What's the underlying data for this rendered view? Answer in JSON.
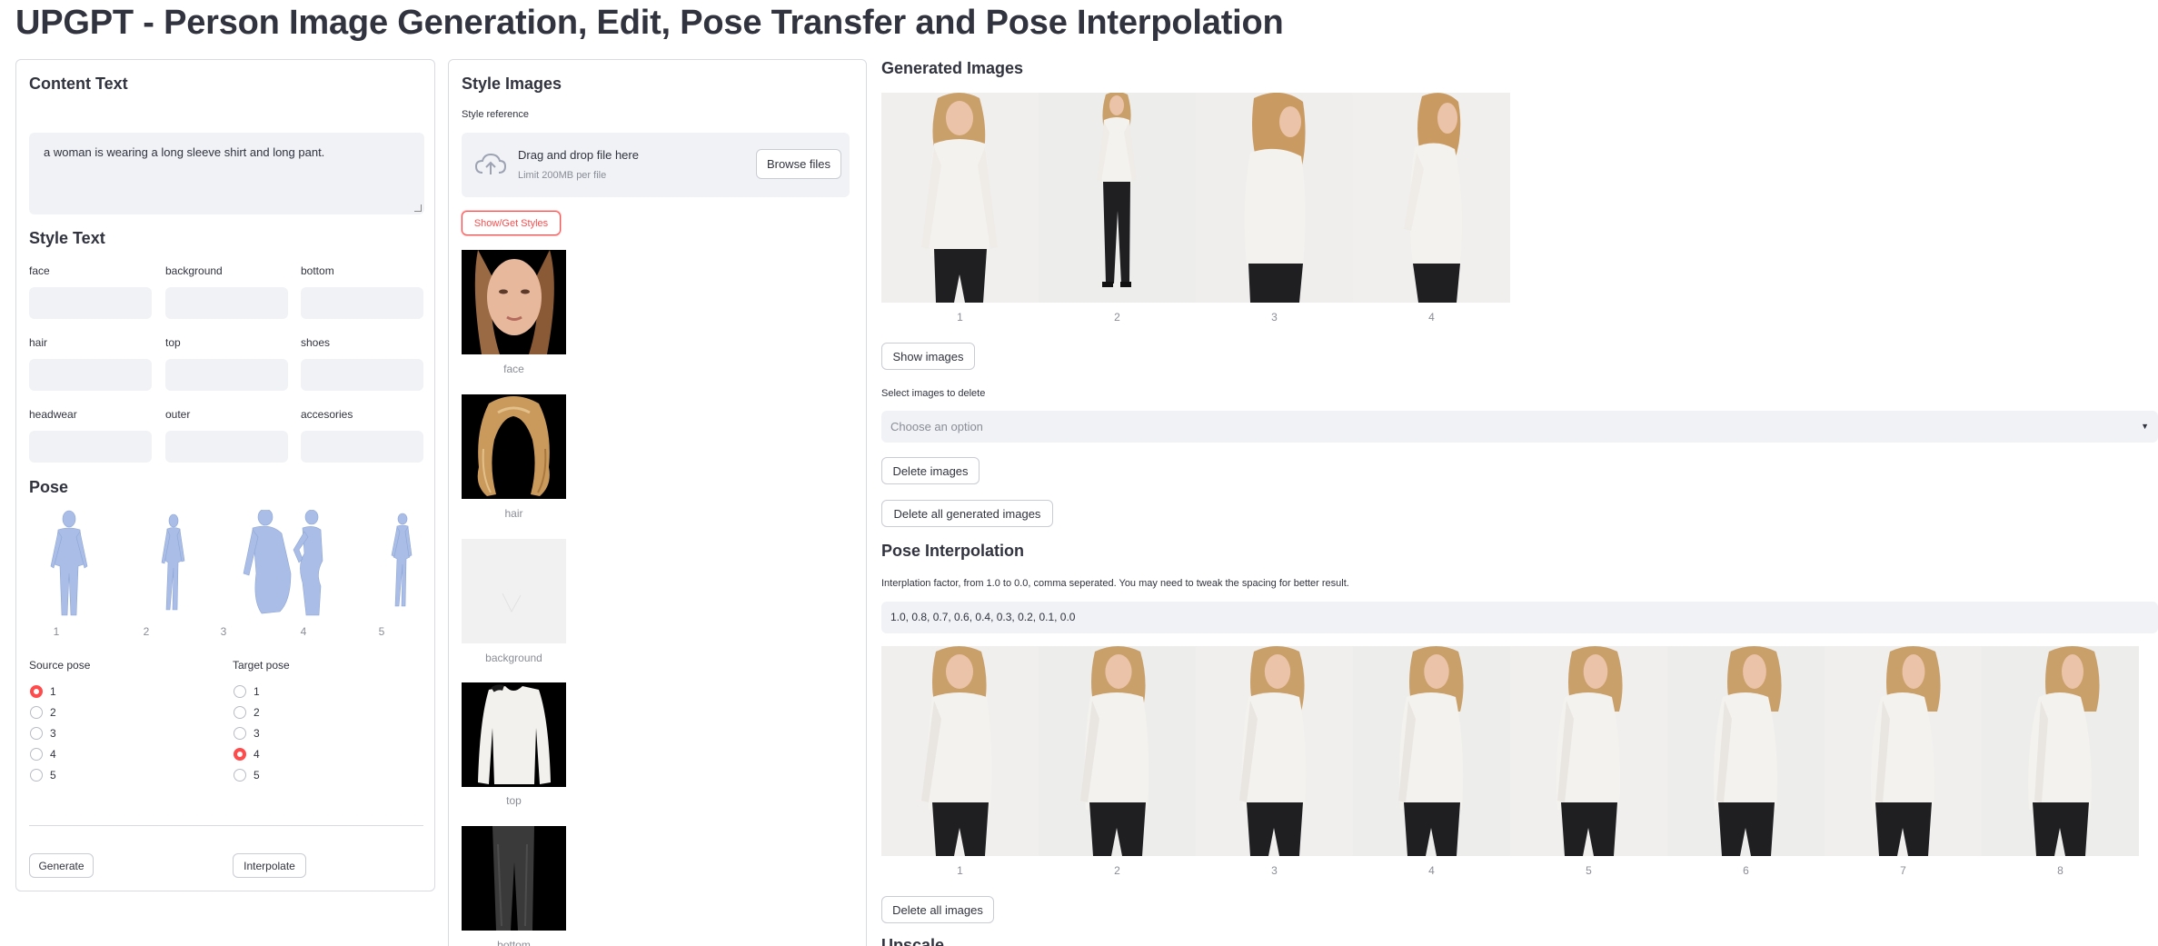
{
  "page": {
    "title": "UPGPT - Person Image Generation, Edit, Pose Transfer and Pose Interpolation"
  },
  "content_text": {
    "header": "Content Text",
    "value": "a woman is wearing a long sleeve shirt and long pant."
  },
  "style_text": {
    "header": "Style Text",
    "fields": [
      {
        "label": "face",
        "value": ""
      },
      {
        "label": "background",
        "value": ""
      },
      {
        "label": "bottom",
        "value": ""
      },
      {
        "label": "hair",
        "value": ""
      },
      {
        "label": "top",
        "value": ""
      },
      {
        "label": "shoes",
        "value": ""
      },
      {
        "label": "headwear",
        "value": ""
      },
      {
        "label": "outer",
        "value": ""
      },
      {
        "label": "accesories",
        "value": ""
      }
    ]
  },
  "pose": {
    "header": "Pose",
    "figures": [
      "1",
      "2",
      "3",
      "4",
      "5"
    ],
    "source_label": "Source pose",
    "target_label": "Target pose",
    "source_options": [
      "1",
      "2",
      "3",
      "4",
      "5"
    ],
    "target_options": [
      "1",
      "2",
      "3",
      "4",
      "5"
    ],
    "source_selected": "1",
    "target_selected": "4",
    "generate_label": "Generate",
    "interpolate_label": "Interpolate"
  },
  "style_images": {
    "header": "Style Images",
    "reference_label": "Style reference",
    "drop_text": "Drag and drop file here",
    "limit_text": "Limit 200MB per file",
    "browse_label": "Browse files",
    "show_styles_label": "Show/Get Styles",
    "items": [
      "face",
      "hair",
      "background",
      "top",
      "bottom"
    ]
  },
  "generated": {
    "header": "Generated Images",
    "captions": [
      "1",
      "2",
      "3",
      "4"
    ],
    "show_label": "Show images",
    "select_label": "Select images to delete",
    "select_placeholder": "Choose an option",
    "delete_label": "Delete images",
    "delete_all_label": "Delete all generated images"
  },
  "interpolation": {
    "header": "Pose Interpolation",
    "factor_label": "Interplation factor, from 1.0 to 0.0, comma seperated. You may need to tweak the spacing for better result.",
    "factor_value": "1.0, 0.8, 0.7, 0.6, 0.4, 0.3, 0.2, 0.1, 0.0",
    "captions": [
      "1",
      "2",
      "3",
      "4",
      "5",
      "6",
      "7",
      "8"
    ],
    "delete_all_label": "Delete all images"
  },
  "upscale": {
    "header": "Upscale"
  },
  "colors": {
    "accent": "#ff4b4b",
    "input_bg": "#f0f2f6",
    "pose_blue": "#a9bde6",
    "text": "#31333f"
  }
}
